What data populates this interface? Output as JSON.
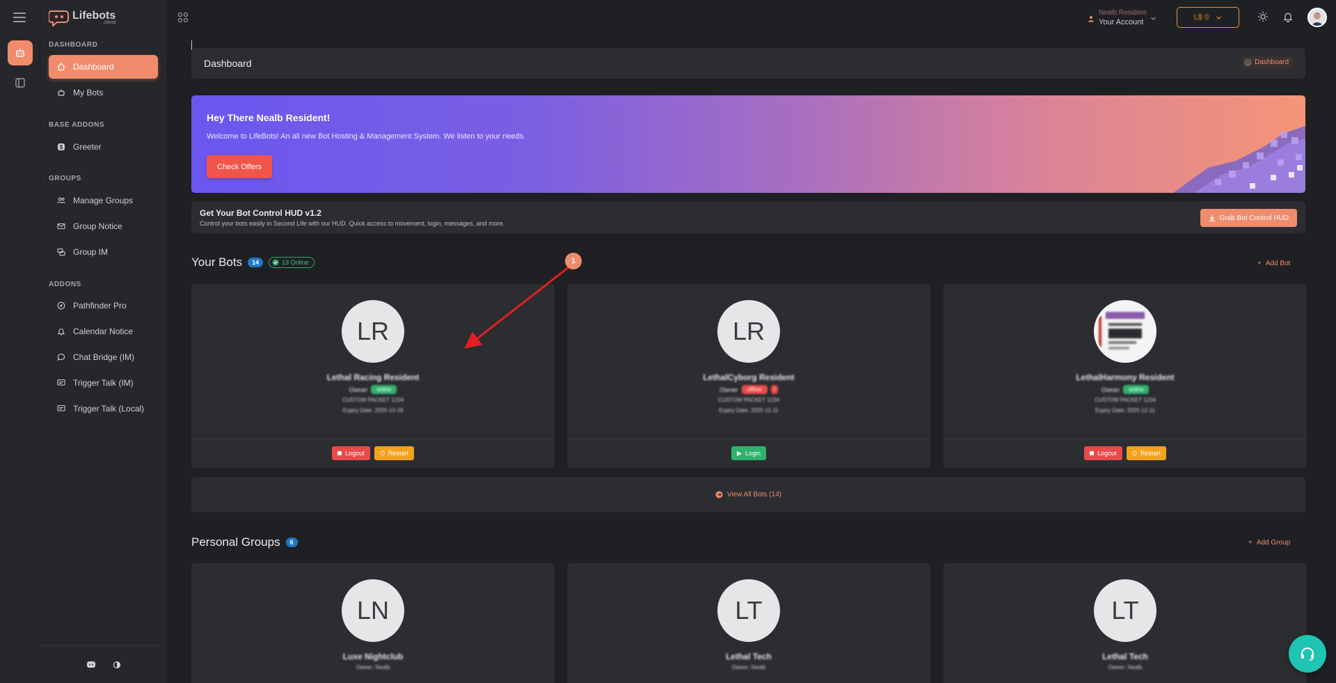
{
  "app": {
    "logo_text": "Lifebots",
    "logo_sub": ".cloud"
  },
  "topbar": {
    "account_name": "Nealb Resident",
    "account_label": "Your Account",
    "currency_value": "L$ 0"
  },
  "sidebar": {
    "sections": {
      "dashboard": "DASHBOARD",
      "base_addons": "BASE ADDONS",
      "groups": "GROUPS",
      "addons": "ADDONS"
    },
    "items": [
      {
        "label": "Dashboard",
        "icon": "home-icon"
      },
      {
        "label": "My Bots",
        "icon": "robot-icon"
      },
      {
        "label": "Greeter",
        "icon": "dollar-icon"
      },
      {
        "label": "Manage Groups",
        "icon": "users-icon"
      },
      {
        "label": "Group Notice",
        "icon": "mail-icon"
      },
      {
        "label": "Group IM",
        "icon": "chat-icon"
      },
      {
        "label": "Pathfinder Pro",
        "icon": "compass-icon"
      },
      {
        "label": "Calendar Notice",
        "icon": "bell-icon"
      },
      {
        "label": "Chat Bridge (IM)",
        "icon": "chat-bubble-icon"
      },
      {
        "label": "Trigger Talk (IM)",
        "icon": "message-icon"
      },
      {
        "label": "Trigger Talk (Local)",
        "icon": "message-icon"
      }
    ]
  },
  "page": {
    "title": "Dashboard",
    "breadcrumb": "Dashboard"
  },
  "hero": {
    "greeting": "Hey There Nealb Resident!",
    "message": "Welcome to LifeBots! An all new Bot Hosting & Management System. We listen to your needs.",
    "button": "Check Offers"
  },
  "hud": {
    "title": "Get Your Bot Control HUD v1.2",
    "description": "Control your bots easily in Second Life with our HUD. Quick access to movement, login, messages, and more.",
    "button": "Grab Bot Control HUD"
  },
  "bots_section": {
    "title": "Your Bots",
    "count": "14",
    "online": "13 Online",
    "add_label": "Add Bot",
    "view_all": "View All Bots (14)"
  },
  "bots": [
    {
      "initials": "LR",
      "name": "Lethal Racing Resident",
      "role": "Owner",
      "status": "online",
      "status_color": "#2fb26c",
      "line1": "CUSTOM PACKET 1234",
      "line2": "Expiry Date: 2025-10-18",
      "actions": [
        {
          "label": "Logout",
          "kind": "red"
        },
        {
          "label": "Restart",
          "kind": "orange"
        }
      ]
    },
    {
      "initials": "LR",
      "name": "LethalCyborg Resident",
      "role": "Owner",
      "status": "offline",
      "status_color": "#ea4a4a",
      "line1": "CUSTOM PACKET 1234",
      "line2": "Expiry Date: 2025-11-11",
      "actions": [
        {
          "label": "Login",
          "kind": "green"
        }
      ]
    },
    {
      "initials": "",
      "name": "LethalHarmony Resident",
      "role": "Owner",
      "status": "online",
      "status_color": "#2fb26c",
      "line1": "CUSTOM PACKET 1234",
      "line2": "Expiry Date: 2025-12-11",
      "actions": [
        {
          "label": "Logout",
          "kind": "red"
        },
        {
          "label": "Restart",
          "kind": "orange"
        }
      ]
    }
  ],
  "groups_section": {
    "title": "Personal Groups",
    "count": "6",
    "add_label": "Add Group"
  },
  "groups": [
    {
      "initials": "LN",
      "name": "Luxe Nightclub",
      "sub": "Owner: Nealb"
    },
    {
      "initials": "LT",
      "name": "Lethal Tech",
      "sub": "Owner: Nealb"
    },
    {
      "initials": "LT",
      "name": "Lethal Tech",
      "sub": "Owner: Nealb"
    }
  ],
  "annotation": {
    "marker": "1"
  },
  "colors": {
    "accent": "#f08c6c",
    "success": "#2fb26c",
    "danger": "#ea4a4a",
    "warning": "#f4a21e",
    "info": "#1e78c8",
    "support": "#1fc4b3"
  }
}
